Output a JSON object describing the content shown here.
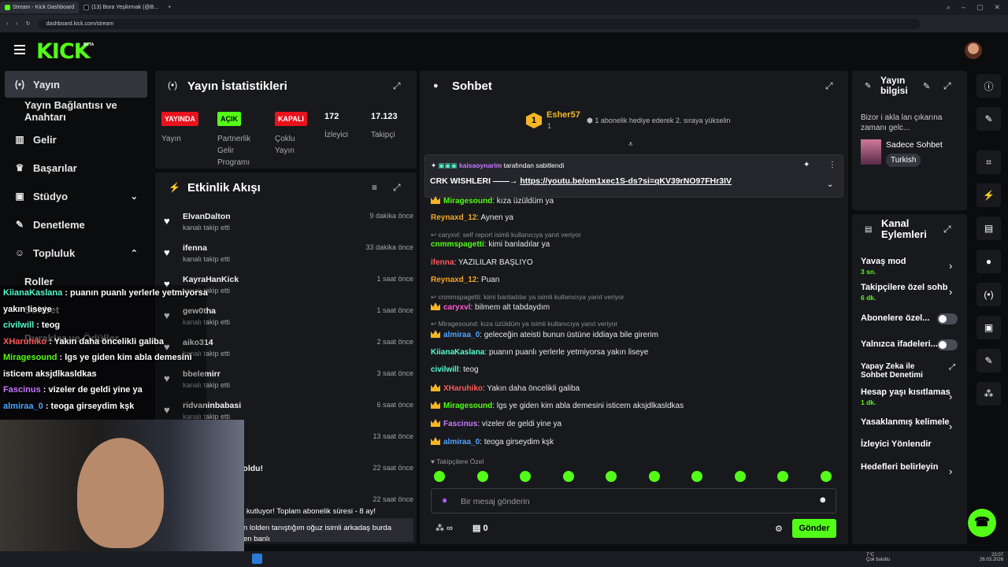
{
  "browser": {
    "tabs": [
      {
        "label": "Stream - Kick Dashboard",
        "active": true
      },
      {
        "label": "(13) Bora Yeşilırmak (@B..."
      }
    ],
    "new_tab": "+",
    "url": "dashboard.kick.com/stream"
  },
  "header": {
    "logo": "KICK",
    "beta": "BETA"
  },
  "sidebar": {
    "items": [
      {
        "label": "Yayın",
        "icon": "(•)",
        "active": true
      },
      {
        "label": "Yayın Bağlantısı ve Anahtarı",
        "icon": "",
        "sub": true
      },
      {
        "label": "Gelir",
        "icon": "▦"
      },
      {
        "label": "Başarılar",
        "icon": "🏆"
      },
      {
        "label": "Stüdyo",
        "icon": "▣",
        "chev": "⌄"
      },
      {
        "label": "Denetleme",
        "icon": "🔧"
      },
      {
        "label": "Topluluk",
        "icon": "👥",
        "chev": "⌃"
      },
      {
        "label": "Roller",
        "icon": "",
        "sub": true
      },
      {
        "label": "Sohbet",
        "icon": "",
        "sub": true
      },
      {
        "label": "Duraklar ve Ödüller",
        "icon": "",
        "sub": true
      }
    ]
  },
  "stats": {
    "title": "Yayın İstatistikleri",
    "badges": [
      "YAYINDA",
      "AÇIK",
      "KAPALI"
    ],
    "labels": [
      "Yayın",
      "Partnerlik\nGelir\nProgramı",
      "Çoklu\nYayın",
      "İzleyici",
      "Takipçi"
    ],
    "viewers": "172",
    "followers": "17.123"
  },
  "activity": {
    "title": "Etkinlik Akışı",
    "items": [
      {
        "user": "ElvanDalton",
        "desc": "kanalı takip etti",
        "time": "9 dakika önce"
      },
      {
        "user": "ifenna",
        "desc": "kanalı takip etti",
        "time": "33 dakika önce"
      },
      {
        "user": "KayraHanKick",
        "desc": "kanalı takip etti",
        "time": "1 saat önce"
      },
      {
        "user": "gew0tha",
        "desc": "kanalı takip etti",
        "time": "1 saat önce"
      },
      {
        "user": "aiko314",
        "desc": "kanalı takip etti",
        "time": "2 saat önce"
      },
      {
        "user": "bbelemirr",
        "desc": "kanalı takip etti",
        "time": "3 saat önce"
      },
      {
        "user": "ridvaninbabasi",
        "desc": "kanalı takip etti",
        "time": "6 saat önce"
      },
      {
        "user": "",
        "desc": "",
        "time": "13 saat önce"
      },
      {
        "user": "yeniden abone oldu!",
        "desc": "ular",
        "time": "22 saat önce"
      },
      {
        "user": "",
        "desc": "",
        "time": "22 saat önce"
      }
    ],
    "extra1": "n kutluyor! Toplam abonelik süresi - 8 ay!",
    "extra2": "n lolden tanıştığım oğuz isimli arkadaş burda",
    "extra3": "en banlı"
  },
  "chat": {
    "title": "Sohbet",
    "top_user": "Esher57",
    "top_rank": "1",
    "top_count": "1",
    "gift_text": "1 abonelik hediye ederek 2. sıraya yükselin",
    "pinned_by": "kaisaoynarim",
    "pinned_suffix": "tarafından sabitlendi",
    "pinned_text": "CRK WISHLERI ——→",
    "pinned_link": "https://youtu.be/om1xec1S-ds?si=qKV39rNO97FHr3IV",
    "messages": [
      {
        "user": "Miragesound",
        "color": "#53fc18",
        "text": "kıza üzüldüm ya",
        "crown": true
      },
      {
        "user": "Reynaxd_12",
        "color": "#f5a623",
        "text": "Aynen ya"
      },
      {
        "reply": "caryxvl: self report isimli kullanıcıya yanıt veriyor"
      },
      {
        "user": "cnmmspagetti",
        "color": "#53fc18",
        "text": "kimi banladılar ya"
      },
      {
        "user": "ifenna",
        "color": "#ff5a5a",
        "text": "YAZILILAR BAŞLIYO"
      },
      {
        "user": "Reynaxd_12",
        "color": "#f5a623",
        "text": "Puan"
      },
      {
        "reply": "cnmmspagetti: kimi banladılar ya isimli kullanıcıya yanıt veriyor"
      },
      {
        "user": "caryxvl",
        "color": "#ff5ad2",
        "text": "bilmem alt tabdaydım",
        "crown": true
      },
      {
        "reply": "Miragesound: kıza üzüldüm ya isimli kullanıcıya yanıt veriyor"
      },
      {
        "user": "almiraa_0",
        "color": "#4da3ff",
        "text": "geleceğin ateisti bunun üstüne iddiaya bile girerim",
        "crown": true
      },
      {
        "user": "KiianaKaslana",
        "color": "#53fcd0",
        "text": "puanın puanlı yerlerle yetmiyorsa yakın liseye"
      },
      {
        "user": "civilwill",
        "color": "#53fcd0",
        "text": "teog"
      },
      {
        "user": "XHaruhiko",
        "color": "#ff5a5a",
        "text": "Yakın daha öncelikli galiba",
        "crown": true
      },
      {
        "user": "Miragesound",
        "color": "#53fc18",
        "text": "lgs ye giden kim abla demesini isticem aksjdlkasldkas",
        "crown": true
      },
      {
        "user": "Fascinus",
        "color": "#c779ff",
        "text": "vizeler de geldi yine ya",
        "crown": true
      },
      {
        "user": "almiraa_0",
        "color": "#4da3ff",
        "text": "teoga girseydim kşk",
        "crown": true
      }
    ],
    "followers_only": "Takipçilere Özel",
    "input_placeholder": "Bir mesaj gönderin",
    "points": "∞",
    "kicks": "0",
    "send": "Gönder"
  },
  "overlay": [
    {
      "user": "KiianaKaslana",
      "color": "#53fcd0",
      "text": "puanın puanlı yerlerle yetmiyorsa"
    },
    {
      "user": "",
      "color": "#fff",
      "text": "yakın liseye"
    },
    {
      "user": "civilwill",
      "color": "#53fcd0",
      "text": "teog"
    },
    {
      "user": "XHaruhiko",
      "color": "#ff5a5a",
      "text": "Yakın daha öncelikli galiba"
    },
    {
      "user": "Miragesound",
      "color": "#53fc18",
      "text": "lgs ye giden kim abla demesini"
    },
    {
      "user": "",
      "color": "#fff",
      "text": "isticem aksjdlkasldkas"
    },
    {
      "user": "Fascinus",
      "color": "#c779ff",
      "text": "vizeler de geldi yine ya"
    },
    {
      "user": "almiraa_0",
      "color": "#4da3ff",
      "text": "teoga girseydim kşk"
    }
  ],
  "stream_info": {
    "title": "Yayın bilgisi",
    "text": "Bizor i akla lan çıkarına zamanı gelc...",
    "category": "Sadece Sohbet",
    "language": "Turkish"
  },
  "channel_actions": {
    "title": "Kanal Eylemleri",
    "items": [
      {
        "label": "Yavaş mod",
        "sub": "3 sn.",
        "type": "chev"
      },
      {
        "label": "Takipçilere özel sohb",
        "sub": "6 dk.",
        "type": "chev"
      },
      {
        "label": "Abonelere özel...",
        "type": "toggle"
      },
      {
        "label": "Yalnızca ifadeleri...",
        "type": "toggle"
      },
      {
        "label": "Yapay Zeka ile Sohbet Denetimi",
        "type": "ext"
      },
      {
        "label": "Hesap yaşı kısıtlamas",
        "sub": "1 dk.",
        "type": "chev"
      },
      {
        "label": "Yasaklanmış kelimele",
        "type": "chev"
      },
      {
        "label": "İzleyici Yönlendir",
        "type": "none"
      },
      {
        "label": "Hedefleri belirleyin",
        "type": "chev"
      }
    ]
  },
  "taskbar": {
    "weather": "7°C",
    "weather_desc": "Çok bulutlu",
    "time": "23:07",
    "date": "26.03.2026"
  },
  "colors": {
    "brand": "#53fc18",
    "panel": "#18191c",
    "bg": "#0b0c0e"
  }
}
